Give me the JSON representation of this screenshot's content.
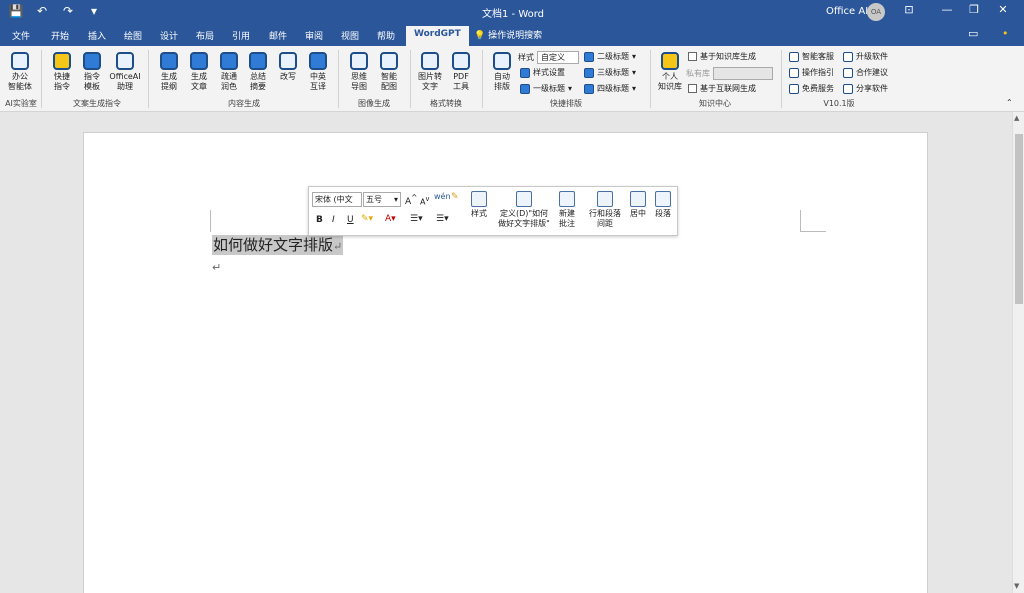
{
  "titlebar": {
    "doc_title": "文档1 - Word",
    "user_name": "Office AI",
    "avatar_initials": "OA",
    "save_icon": "💾",
    "undo_icon": "↶",
    "redo_icon": "↷",
    "customize_icon": "▾",
    "display_options_icon": "⊡",
    "minimize_icon": "—",
    "restore_icon": "❐",
    "close_icon": "✕"
  },
  "tabs": [
    "文件",
    "开始",
    "插入",
    "绘图",
    "设计",
    "布局",
    "引用",
    "邮件",
    "审阅",
    "视图",
    "帮助",
    "WordGPT"
  ],
  "tell_me": "操作说明搜索",
  "ribbon": {
    "lab": {
      "btn1": "办公\n智能体",
      "group": "AI实验室"
    },
    "copy_cmd": {
      "btn1": "快捷\n指令",
      "btn2": "指令\n模板",
      "btn3": "OfficeAI\n助理",
      "group": "文案生成指令"
    },
    "content": {
      "btn1": "生成\n提纲",
      "btn2": "生成\n文章",
      "btn3": "疏通\n润色",
      "btn4": "总结\n摘要",
      "btn5": "改写",
      "btn6": "中英\n互译",
      "group": "内容生成"
    },
    "image": {
      "btn1": "思维\n导图",
      "btn2": "智能\n配图",
      "group": "图像生成"
    },
    "format": {
      "btn1": "图片转\n文字",
      "btn2": "PDF\n工具",
      "group": "格式转换"
    },
    "layout": {
      "btn1": "自动\n排版",
      "style_label": "样式",
      "style_value": "自定义",
      "style_settings": "样式设置",
      "h1": "一级标题",
      "h2": "二级标题",
      "h3": "三级标题",
      "h4": "四级标题",
      "group": "快捷排版"
    },
    "kb": {
      "btn1": "个人\n知识库",
      "opt1": "基于知识库生成",
      "private_label": "私有库",
      "opt2": "基于互联网生成",
      "group": "知识中心"
    },
    "version": {
      "item1": "智能客服",
      "item2": "升级软件",
      "item3": "操作指引",
      "item4": "合作建议",
      "item5": "免费服务",
      "item6": "分享软件",
      "group": "V10.1版"
    }
  },
  "document": {
    "selected_text": "如何做好文字排版",
    "para_mark": "↵"
  },
  "mini_toolbar": {
    "font_name": "宋体 (中文",
    "font_size": "五号",
    "bold": "B",
    "italic": "I",
    "underline": "U",
    "styles_label": "样式",
    "define_label": "定义(D)\"如何\n做好文字排版\"",
    "new_comment_label": "新建\n批注",
    "line_spacing_label": "行和段落\n间距",
    "center_label": "居中",
    "paragraph_label": "段落"
  }
}
